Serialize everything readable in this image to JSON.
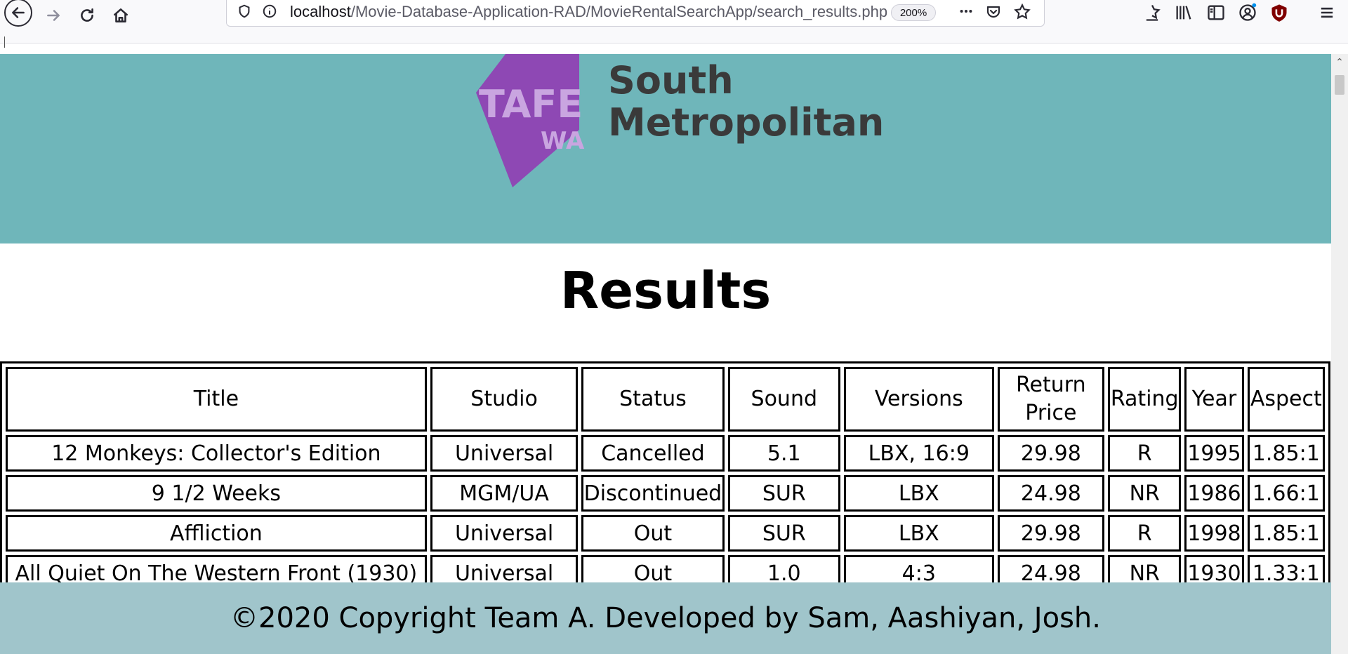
{
  "browser": {
    "url_host": "localhost",
    "url_path": "/Movie-Database-Application-RAD/MovieRentalSearchApp/search_results.php",
    "zoom": "200%"
  },
  "header": {
    "logo_text": [
      "TAFE",
      "WA"
    ],
    "logo_name_line1": "South",
    "logo_name_line2": "Metropolitan",
    "logo_color": "#8e48b4",
    "background": "#6fb6ba"
  },
  "main": {
    "title": "Results",
    "table": {
      "headers": [
        "Title",
        "Studio",
        "Status",
        "Sound",
        "Versions",
        "Return Price",
        "Rating",
        "Year",
        "Aspect"
      ],
      "rows": [
        [
          "12 Monkeys: Collector's Edition",
          "Universal",
          "Cancelled",
          "5.1",
          "LBX, 16:9",
          "29.98",
          "R",
          "1995",
          "1.85:1"
        ],
        [
          "9 1/2 Weeks",
          "MGM/UA",
          "Discontinued",
          "SUR",
          "LBX",
          "24.98",
          "NR",
          "1986",
          "1.66:1"
        ],
        [
          "Affliction",
          "Universal",
          "Out",
          "SUR",
          "LBX",
          "29.98",
          "R",
          "1998",
          "1.85:1"
        ],
        [
          "All Quiet On The Western Front (1930)",
          "Universal",
          "Out",
          "1.0",
          "4:3",
          "24.98",
          "NR",
          "1930",
          "1.33:1"
        ]
      ]
    }
  },
  "footer": {
    "text": "©2020 Copyright Team A. Developed by Sam, Aashiyan, Josh.",
    "background": "#a0c5cb"
  }
}
